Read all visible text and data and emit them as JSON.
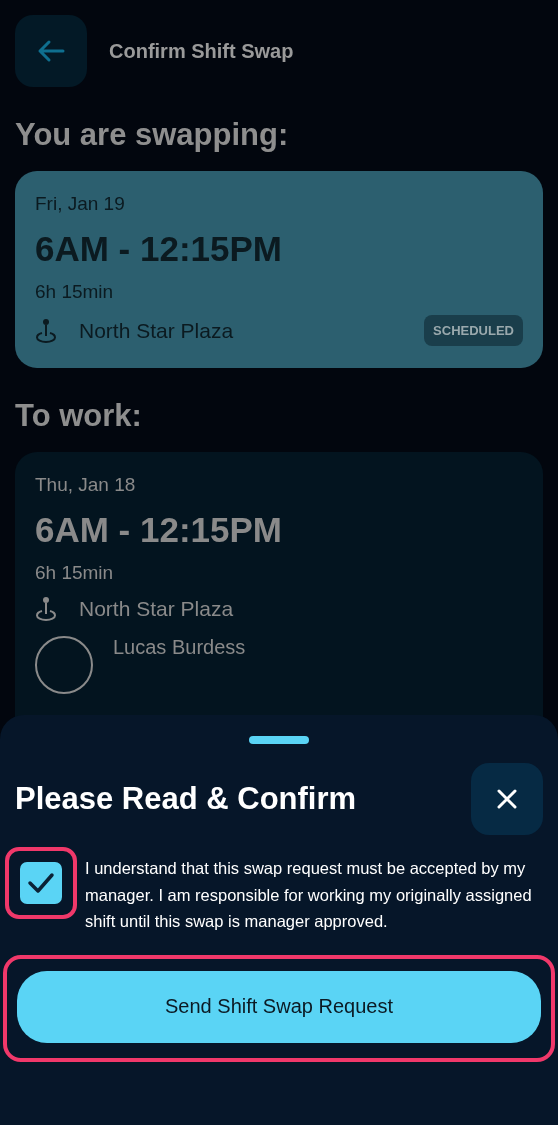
{
  "header": {
    "title": "Confirm Shift Swap"
  },
  "swapping": {
    "heading": "You are swapping:",
    "shift": {
      "date": "Fri, Jan 19",
      "time": "6AM - 12:15PM",
      "duration": "6h 15min",
      "location": "North Star Plaza",
      "status": "SCHEDULED"
    }
  },
  "to_work": {
    "heading": "To work:",
    "shift": {
      "date": "Thu, Jan 18",
      "time": "6AM - 12:15PM",
      "duration": "6h 15min",
      "location": "North Star Plaza",
      "coworker": "Lucas Burdess"
    }
  },
  "sheet": {
    "title": "Please Read & Confirm",
    "agreement": {
      "checked": true,
      "text": "I understand that this swap request must be accepted by my manager. I am responsible for working my originally assigned shift until this swap is manager approved."
    },
    "button": "Send Shift Swap Request"
  }
}
